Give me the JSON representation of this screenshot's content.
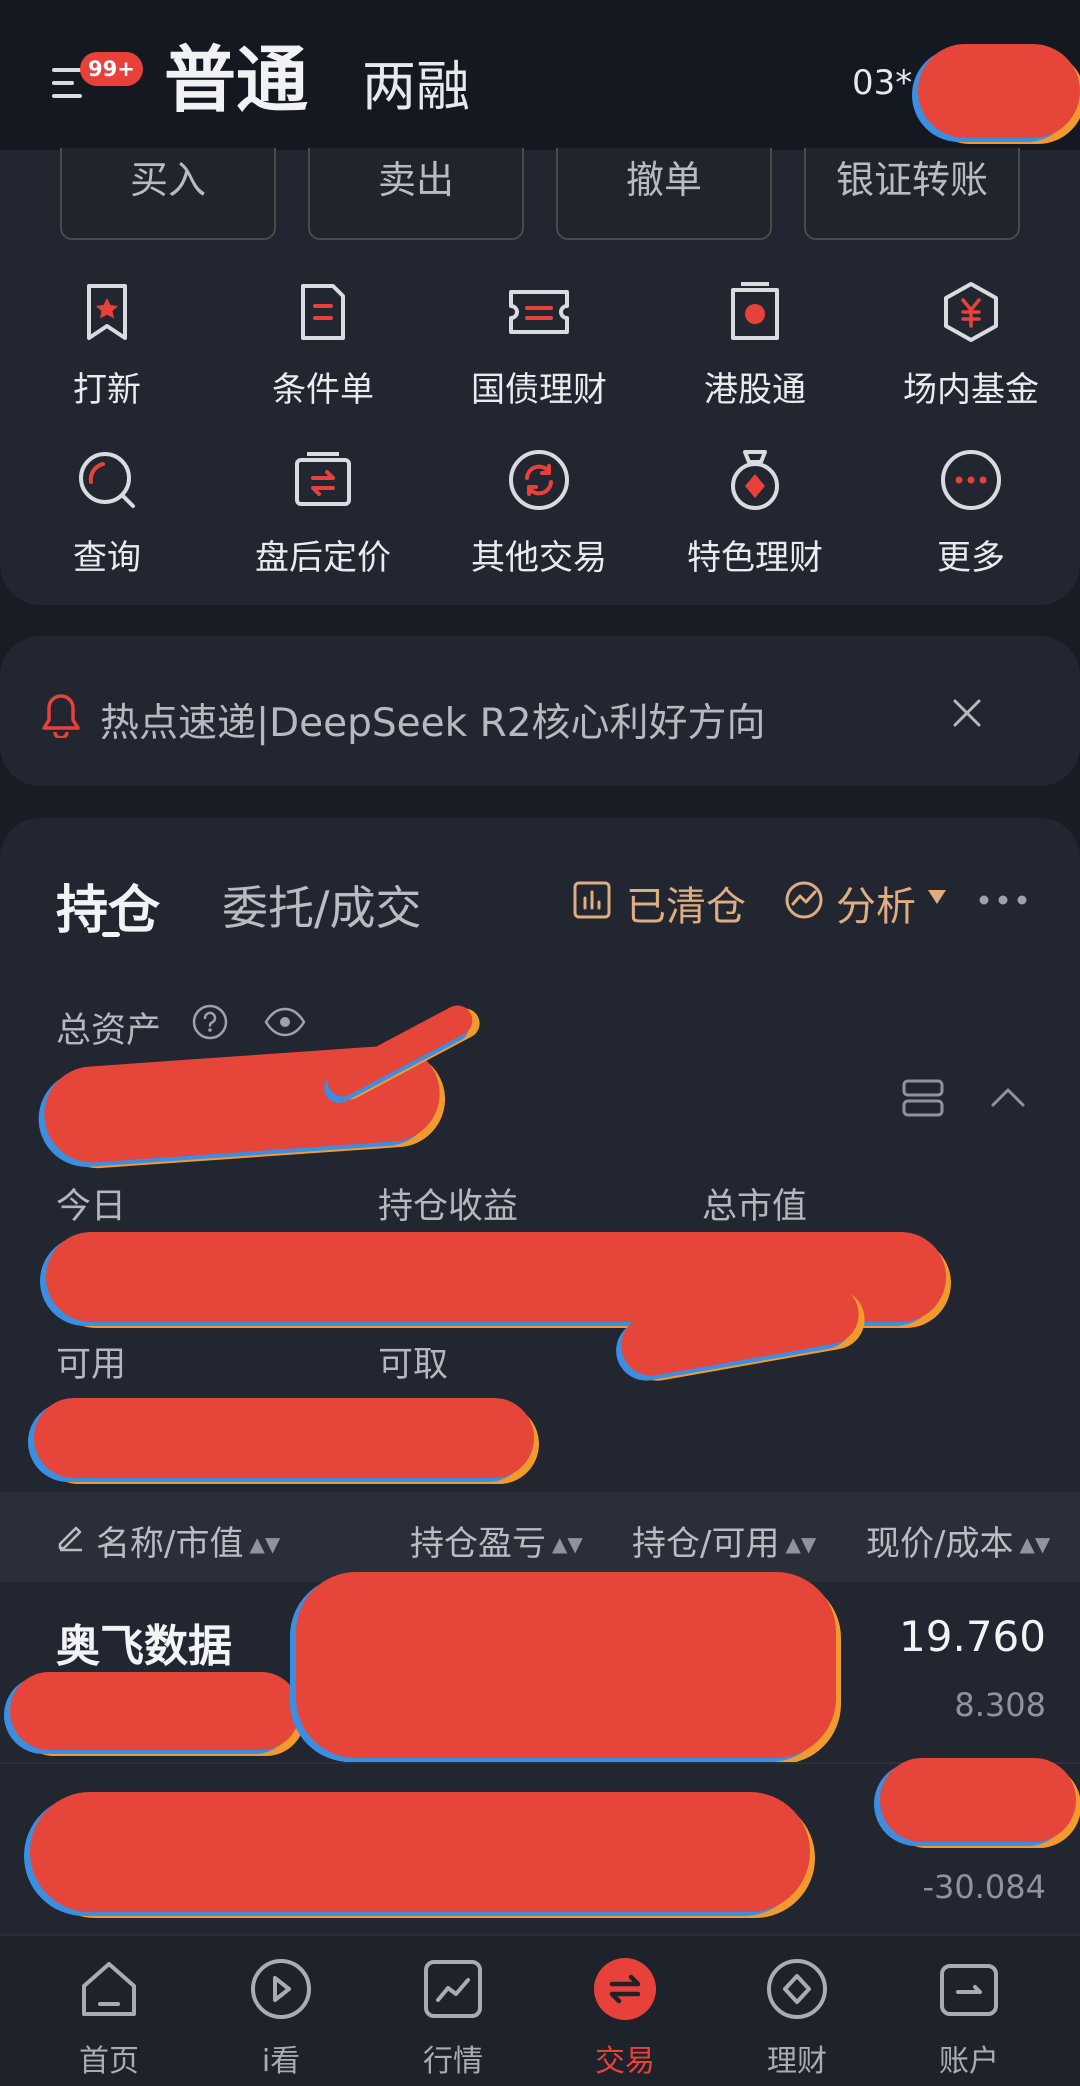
{
  "header": {
    "badge": "99+",
    "tab_main": "普通",
    "tab_sub": "两融",
    "account": "03*"
  },
  "quick_actions": [
    "买入",
    "卖出",
    "撤单",
    "银证转账"
  ],
  "functions_row1": [
    "打新",
    "条件单",
    "国债理财",
    "港股通",
    "场内基金"
  ],
  "functions_row2": [
    "查询",
    "盘后定价",
    "其他交易",
    "特色理财",
    "更多"
  ],
  "notice": {
    "text": "热点速递|DeepSeek R2核心利好方向"
  },
  "holdings": {
    "tab_positions": "持仓",
    "tab_orders": "委托/成交",
    "cleared": "已清仓",
    "analysis": "分析",
    "total_assets_label": "总资产",
    "today_label": "今日",
    "position_pnl_label": "持仓收益",
    "market_value_label": "总市值",
    "available_label": "可用",
    "withdrawable_label": "可取"
  },
  "table": {
    "headers": [
      "名称/市值",
      "持仓盈亏",
      "持仓/可用",
      "现价/成本"
    ],
    "rows": [
      {
        "name": "奥飞数据",
        "price": "19.760",
        "cost": "8.308"
      },
      {
        "name": "",
        "price": "",
        "cost": "-30.084"
      }
    ]
  },
  "bottom_nav": [
    "首页",
    "i看",
    "行情",
    "交易",
    "理财",
    "账户"
  ],
  "colors": {
    "accent": "#e8413a",
    "gold": "#dcae82",
    "bg": "#181c24",
    "panel": "#222630"
  }
}
